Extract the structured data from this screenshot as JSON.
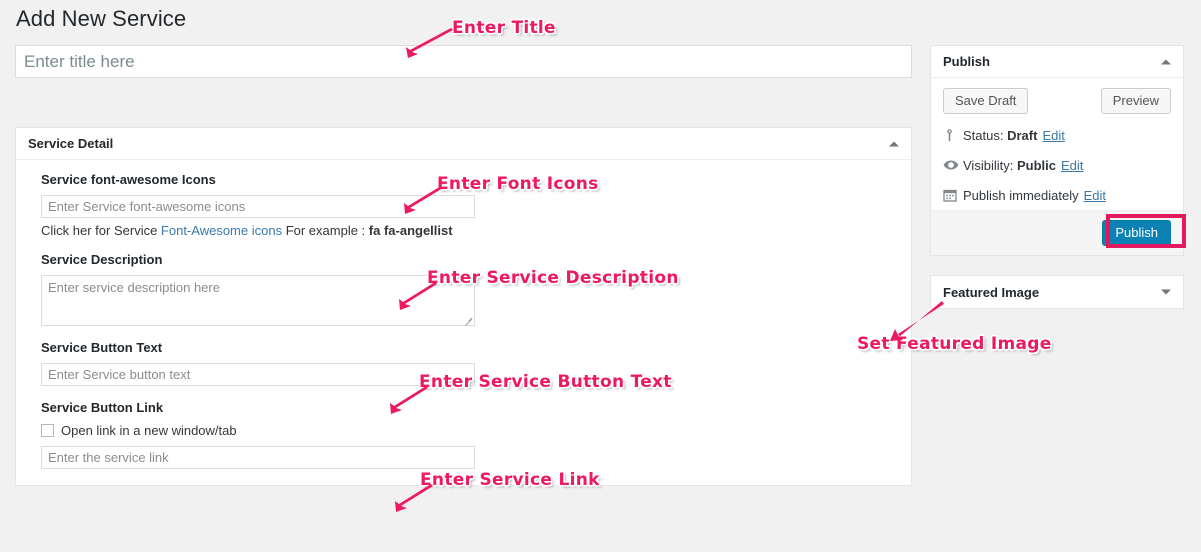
{
  "page": {
    "title": "Add New Service"
  },
  "title_field": {
    "placeholder": "Enter title here",
    "value": ""
  },
  "service_detail": {
    "panel_title": "Service Detail",
    "toggle_icon": "chevron-up-icon",
    "fields": {
      "font_icons": {
        "label": "Service font-awesome Icons",
        "placeholder": "Enter Service font-awesome icons",
        "value": "",
        "hint_prefix": "Click her for Service ",
        "hint_link": "Font-Awesome icons",
        "hint_middle": " For example : ",
        "hint_example": "fa fa-angellist"
      },
      "description": {
        "label": "Service Description",
        "placeholder": "Enter service description here",
        "value": ""
      },
      "button_text": {
        "label": "Service Button Text",
        "placeholder": "Enter Service button text",
        "value": ""
      },
      "button_link": {
        "label": "Service Button Link",
        "checkbox_label": "Open link in a new window/tab",
        "checked": false,
        "placeholder": "Enter the service link",
        "value": ""
      }
    }
  },
  "publish_box": {
    "title": "Publish",
    "toggle_icon": "chevron-up-icon",
    "save_draft_label": "Save Draft",
    "preview_label": "Preview",
    "status": {
      "icon": "pin-icon",
      "label": "Status:",
      "value": "Draft",
      "edit_label": "Edit"
    },
    "visibility": {
      "icon": "eye-icon",
      "label": "Visibility:",
      "value": "Public",
      "edit_label": "Edit"
    },
    "schedule": {
      "icon": "calendar-icon",
      "label": "Publish immediately",
      "edit_label": "Edit"
    },
    "publish_button_label": "Publish",
    "publish_button_color": "#0c82b4",
    "highlight_color": "#e3185e"
  },
  "featured_image_box": {
    "title": "Featured Image",
    "toggle_icon": "chevron-down-icon"
  },
  "annotations": {
    "color": "#ec1a5f",
    "items": [
      {
        "text": "Enter Title"
      },
      {
        "text": "Enter Font Icons"
      },
      {
        "text": "Enter Service Description"
      },
      {
        "text": "Enter Service Button Text"
      },
      {
        "text": "Enter Service Link"
      },
      {
        "text": "Set Featured Image"
      }
    ]
  }
}
